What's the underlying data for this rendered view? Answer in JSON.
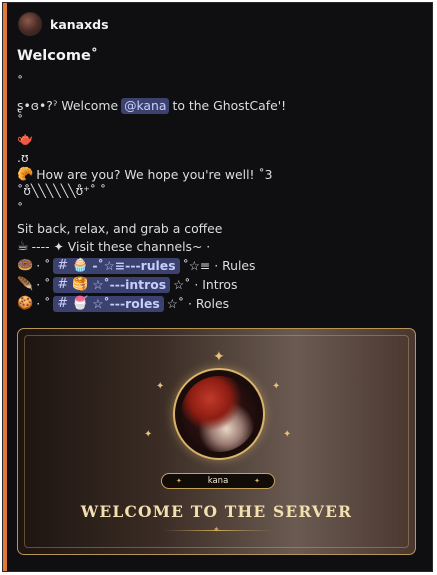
{
  "author": {
    "name": "kanaxds"
  },
  "message": {
    "title": "Welcome˚",
    "dot1": "˚",
    "line_welcome_prefix": "ʂ•ɞ•?ˀ Welcome",
    "mention": "@kana",
    "line_welcome_suffix": "to the GhostCafe'!",
    "dot2": "˚",
    "teapot_emoji": "🫖",
    "kaomoji_line": ".ʊ",
    "croissant_emoji": "🥐",
    "how_are_you": "How are you? We hope you're well! ˚3",
    "deco_line": "˚ʊ̊╲╲╲╲╲╲ʊ̊⁺˚ ˚",
    "dot3": "˚",
    "sit_back": "Sit back, relax, and grab a coffee",
    "visit_line_text": "---- ✦ Visit these channels~ ·",
    "coffee_emoji": "☕",
    "channels": [
      {
        "emoji": "🍩",
        "prefix": "· ˚",
        "channel_emoji": "🧁",
        "channel_name": "-˚☆≡---rules",
        "suffix": "˚☆≡ · Rules"
      },
      {
        "emoji": "🪶",
        "prefix": "· ˚",
        "channel_emoji": "🥞",
        "channel_name": "☆˚---intros",
        "suffix": "☆˚ · Intros"
      },
      {
        "emoji": "🍪",
        "prefix": "· ˚",
        "channel_emoji": "🍧",
        "channel_name": "☆˚---roles",
        "suffix": "☆˚ · Roles"
      }
    ]
  },
  "card": {
    "tag_name": "kana",
    "welcome_text": "WELCOME TO THE SERVER"
  },
  "colors": {
    "accent": "#e07a3a",
    "mention_bg": "#3c4270",
    "gold": "#d9b36a"
  }
}
